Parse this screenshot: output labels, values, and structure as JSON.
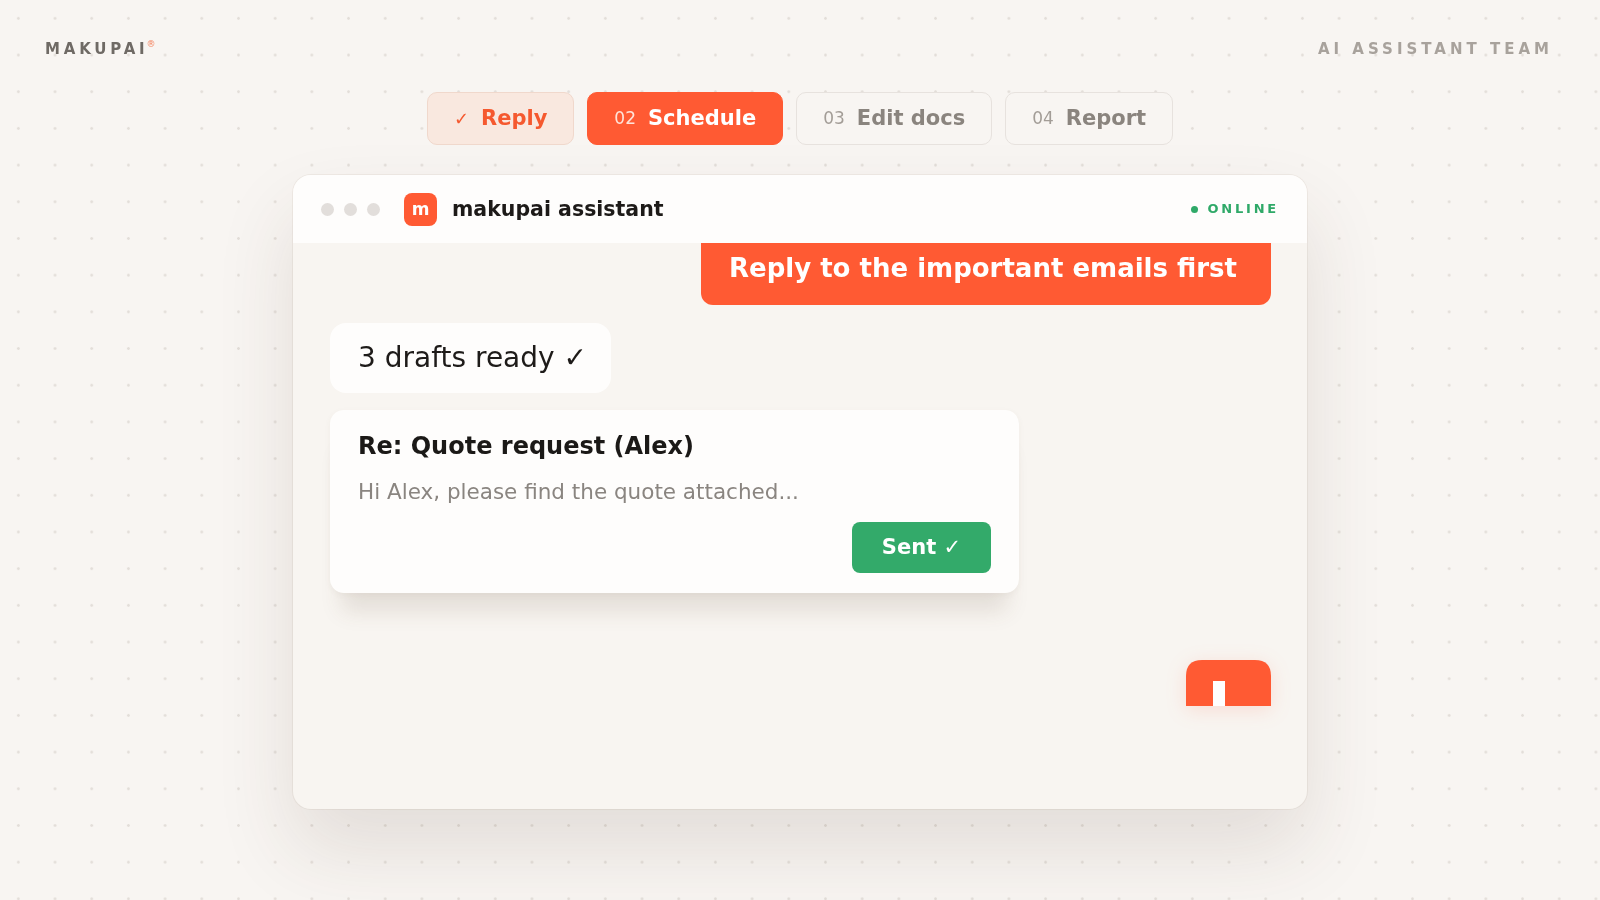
{
  "brand": {
    "name": "MAKUPAI",
    "registered_mark": "®"
  },
  "team_label": "AI ASSISTANT TEAM",
  "steps": [
    {
      "marker": "✓",
      "label": "Reply",
      "done": true,
      "selected": false
    },
    {
      "marker": "02",
      "label": "Schedule",
      "done": false,
      "selected": true
    },
    {
      "marker": "03",
      "label": "Edit docs",
      "done": false,
      "selected": false
    },
    {
      "marker": "04",
      "label": "Report",
      "done": false,
      "selected": false
    }
  ],
  "chat_window": {
    "title": "makupai assistant",
    "avatar_letter": "m",
    "status": "ONLINE",
    "messages": [
      {
        "kind": "user",
        "text": "Reply to the important emails first"
      },
      {
        "kind": "bot",
        "text": "3 drafts ready ✓"
      },
      {
        "kind": "email",
        "subject": "Re: Quote request (Alex)",
        "preview": "Hi Alex, please find the quote attached...",
        "action": "Sent ✓"
      },
      {
        "kind": "partial"
      }
    ]
  }
}
